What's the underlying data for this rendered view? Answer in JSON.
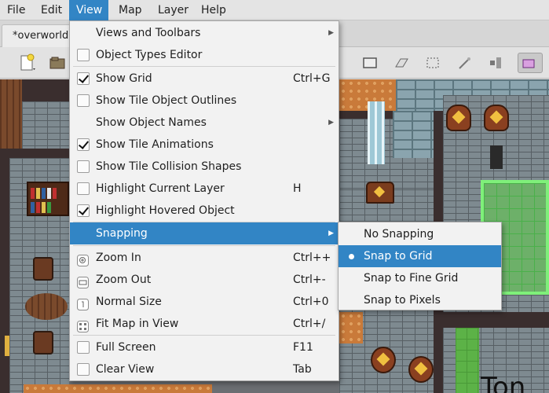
{
  "menubar": {
    "items": [
      {
        "label": "File"
      },
      {
        "label": "Edit"
      },
      {
        "label": "View"
      },
      {
        "label": "Map"
      },
      {
        "label": "Layer"
      },
      {
        "label": "Help"
      }
    ]
  },
  "tabs": [
    {
      "label": "*overworld.j"
    }
  ],
  "map": {
    "visible_text": "Ton"
  },
  "view_menu": {
    "items": [
      {
        "label": "Views and Toolbars",
        "shortcut": "",
        "submenu": true
      },
      {
        "label": "Object Types Editor",
        "shortcut": "",
        "checkbox": false
      },
      {
        "label": "Show Grid",
        "shortcut": "Ctrl+G",
        "checkbox": true
      },
      {
        "label": "Show Tile Object Outlines",
        "shortcut": "",
        "checkbox": false
      },
      {
        "label": "Show Object Names",
        "shortcut": "",
        "submenu": true
      },
      {
        "label": "Show Tile Animations",
        "shortcut": "",
        "checkbox": true
      },
      {
        "label": "Show Tile Collision Shapes",
        "shortcut": "",
        "checkbox": false
      },
      {
        "label": "Highlight Current Layer",
        "shortcut": "H",
        "checkbox": false
      },
      {
        "label": "Highlight Hovered Object",
        "shortcut": "",
        "checkbox": true
      },
      {
        "label": "Snapping",
        "shortcut": "",
        "submenu": true,
        "highlighted": true
      },
      {
        "label": "Zoom In",
        "shortcut": "Ctrl++",
        "icon": "zoom-in-icon"
      },
      {
        "label": "Zoom Out",
        "shortcut": "Ctrl+-",
        "icon": "zoom-out-icon"
      },
      {
        "label": "Normal Size",
        "shortcut": "Ctrl+0",
        "icon": "normal-size-icon"
      },
      {
        "label": "Fit Map in View",
        "shortcut": "Ctrl+/",
        "icon": "fit-map-icon"
      },
      {
        "label": "Full Screen",
        "shortcut": "F11",
        "checkbox": false
      },
      {
        "label": "Clear View",
        "shortcut": "Tab",
        "checkbox": false
      }
    ]
  },
  "snap_menu": {
    "items": [
      {
        "label": "No Snapping"
      },
      {
        "label": "Snap to Grid",
        "selected": true
      },
      {
        "label": "Snap to Fine Grid"
      },
      {
        "label": "Snap to Pixels"
      }
    ]
  },
  "colors": {
    "accent": "#3285c5",
    "menu_bg": "#f2f2f2"
  }
}
